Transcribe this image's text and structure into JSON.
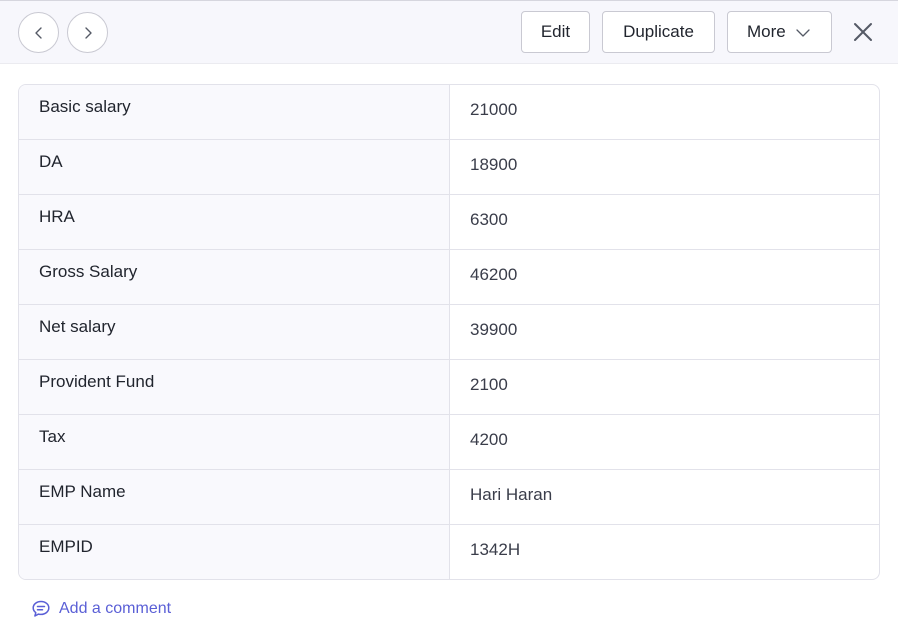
{
  "toolbar": {
    "prev_icon": "chevron-left-icon",
    "next_icon": "chevron-right-icon",
    "edit_label": "Edit",
    "duplicate_label": "Duplicate",
    "more_label": "More",
    "more_icon": "chevron-down-icon",
    "close_icon": "close-icon"
  },
  "record": {
    "rows": [
      {
        "label": "Basic salary",
        "value": "21000"
      },
      {
        "label": "DA",
        "value": "18900"
      },
      {
        "label": "HRA",
        "value": "6300"
      },
      {
        "label": "Gross Salary",
        "value": "46200"
      },
      {
        "label": "Net salary",
        "value": "39900"
      },
      {
        "label": "Provident Fund",
        "value": "2100"
      },
      {
        "label": "Tax",
        "value": "4200"
      },
      {
        "label": "EMP Name",
        "value": "Hari Haran"
      },
      {
        "label": "EMPID",
        "value": "1342H"
      }
    ]
  },
  "comment": {
    "label": "Add a comment",
    "icon": "comment-icon"
  },
  "colors": {
    "accent": "#5a5fd6",
    "toolbar_bg": "#f7f7fc",
    "label_cell_bg": "#f9f9fd",
    "border": "#e2e2ea"
  }
}
